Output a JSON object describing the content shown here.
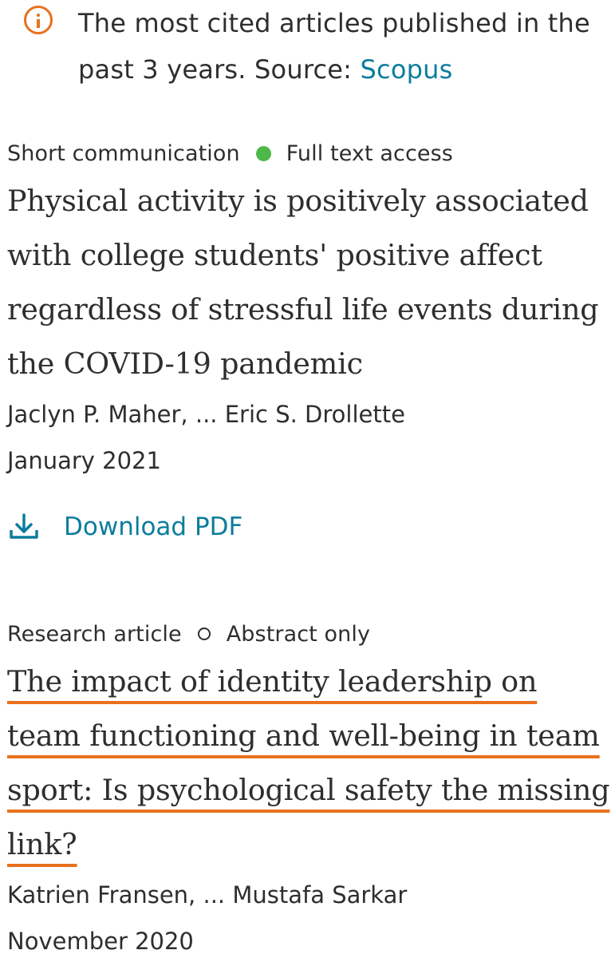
{
  "banner": {
    "icon": "info-icon",
    "text": "The most cited articles published in the past 3 years. Source: ",
    "source_link": "Scopus",
    "accent_color": "#e9711c",
    "link_color": "#0c7d9d"
  },
  "articles": [
    {
      "type": "Short communication",
      "access": "Full text access",
      "access_indicator": "filled-green-dot",
      "title": "Physical activity is positively associated with college students' positive affect regardless of stressful life events during the COVID-19 pandemic",
      "authors": "Jaclyn P. Maher, ... Eric S. Drollette",
      "date": "January 2021",
      "download_label": "Download PDF",
      "download_icon": "download-icon"
    },
    {
      "type": "Research article",
      "access": "Abstract only",
      "access_indicator": "hollow-dot",
      "title": "The impact of identity leadership on team functioning and well-being in team sport: Is psychological safety the missing link?",
      "authors": "Katrien Fransen, ... Mustafa Sarkar",
      "date": "November 2020"
    }
  ]
}
